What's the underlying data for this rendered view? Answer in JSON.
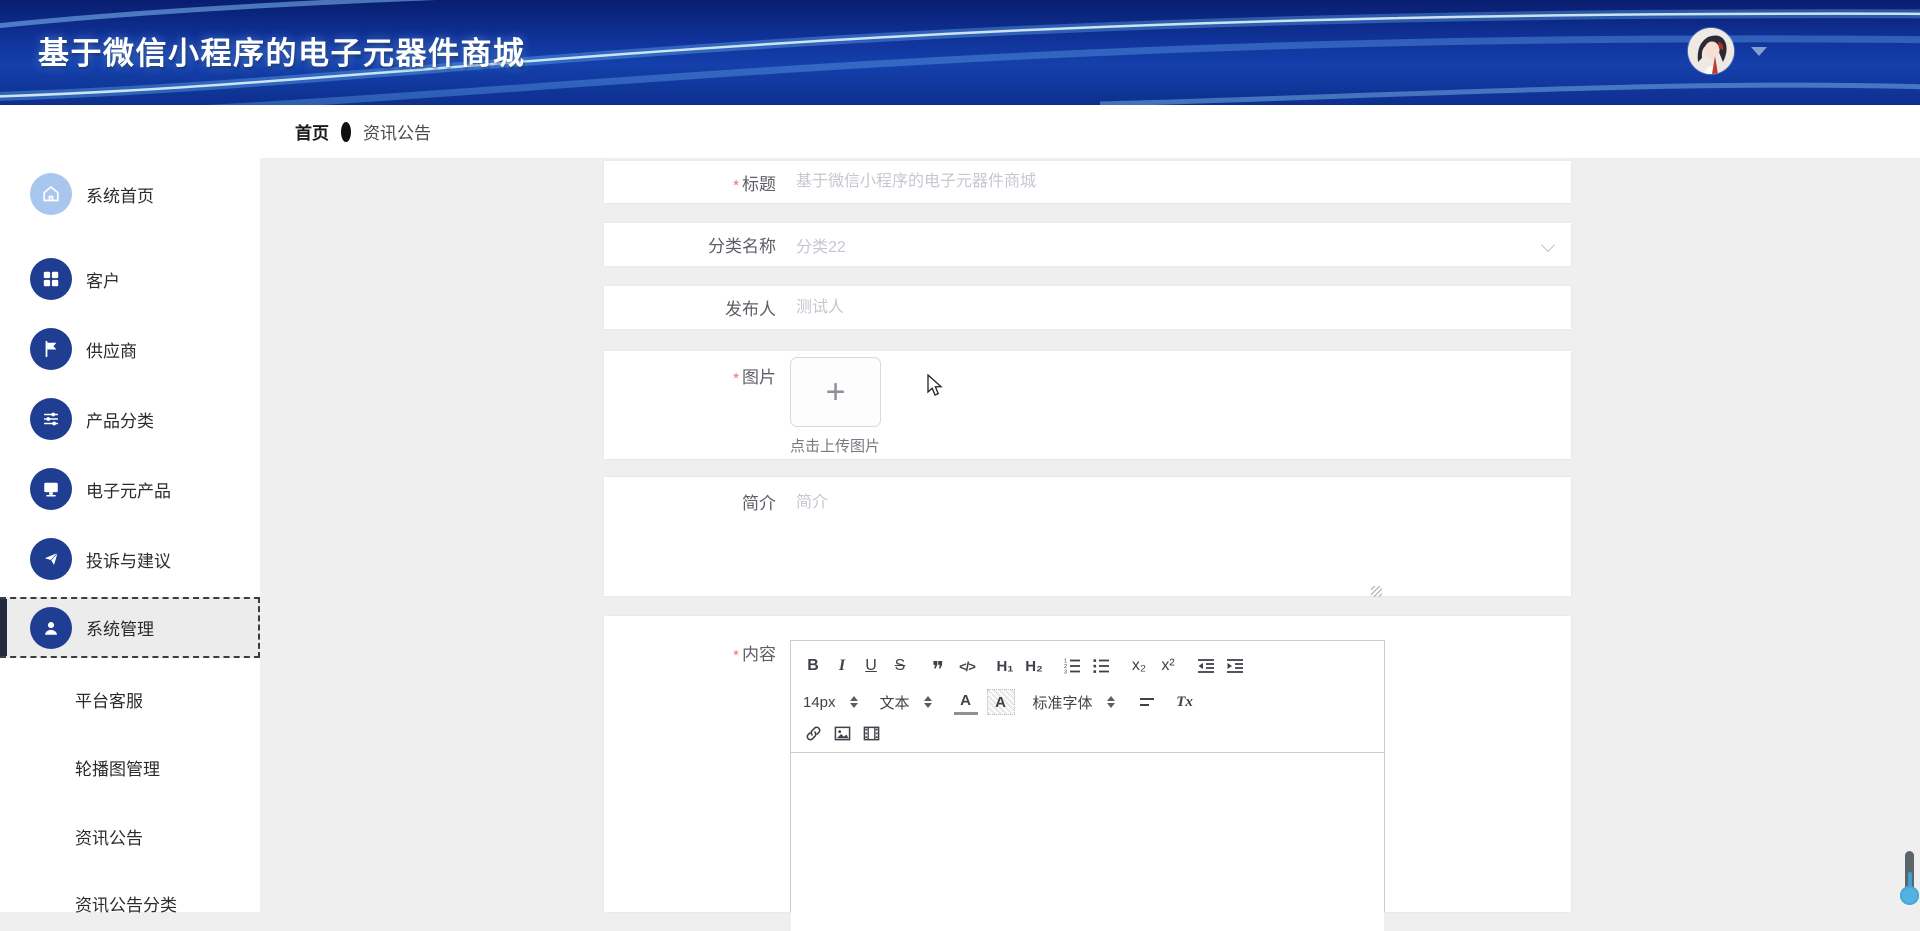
{
  "header": {
    "title": "基于微信小程序的电子元器件商城",
    "user": {
      "avatar_icon": "user-avatar",
      "caret_icon": "caret-down-icon"
    }
  },
  "breadcrumb": {
    "home": "首页",
    "current": "资讯公告"
  },
  "sidebar": {
    "items": [
      {
        "icon": "home-icon",
        "label": "系统首页"
      },
      {
        "icon": "grid-icon",
        "label": "客户"
      },
      {
        "icon": "flag-icon",
        "label": "供应商"
      },
      {
        "icon": "sliders-icon",
        "label": "产品分类"
      },
      {
        "icon": "monitor-icon",
        "label": "电子元产品"
      },
      {
        "icon": "paper-plane-icon",
        "label": "投诉与建议"
      },
      {
        "icon": "user-icon",
        "label": "系统管理",
        "selected": true
      }
    ],
    "sub_items": [
      {
        "label": "平台客服"
      },
      {
        "label": "轮播图管理"
      },
      {
        "label": "资讯公告"
      },
      {
        "label": "资讯公告分类"
      }
    ]
  },
  "form": {
    "title": {
      "label": "标题",
      "required": "*",
      "placeholder": "基于微信小程序的电子元器件商城"
    },
    "category": {
      "label": "分类名称",
      "value": "分类22"
    },
    "publisher": {
      "label": "发布人",
      "placeholder": "测试人"
    },
    "image": {
      "label": "图片",
      "required": "*",
      "plus": "+",
      "hint": "点击上传图片"
    },
    "intro": {
      "label": "简介",
      "placeholder": "简介"
    },
    "content": {
      "label": "内容",
      "required": "*",
      "toolbar": {
        "bold": "B",
        "italic": "I",
        "underline": "U",
        "strike": "S",
        "blockquote": "❞",
        "code": "</>",
        "h1": "H₁",
        "h2": "H₂",
        "subscript": "x₂",
        "superscript": "x²",
        "size_value": "14px",
        "text_value": "文本",
        "font_value": "标准字体",
        "color_letter": "A",
        "bg_letter": "A",
        "clear_format": "Tx"
      }
    }
  },
  "colors": {
    "header_blue_dark": "#081d6e",
    "header_blue": "#1440ab",
    "icon_circle": "#1f3e92",
    "icon_circle_light": "#a9c7ee",
    "required_red": "#f56c6c",
    "placeholder_gray": "#c4c8cf",
    "scroll_thumb_blue": "#54b2e2"
  }
}
